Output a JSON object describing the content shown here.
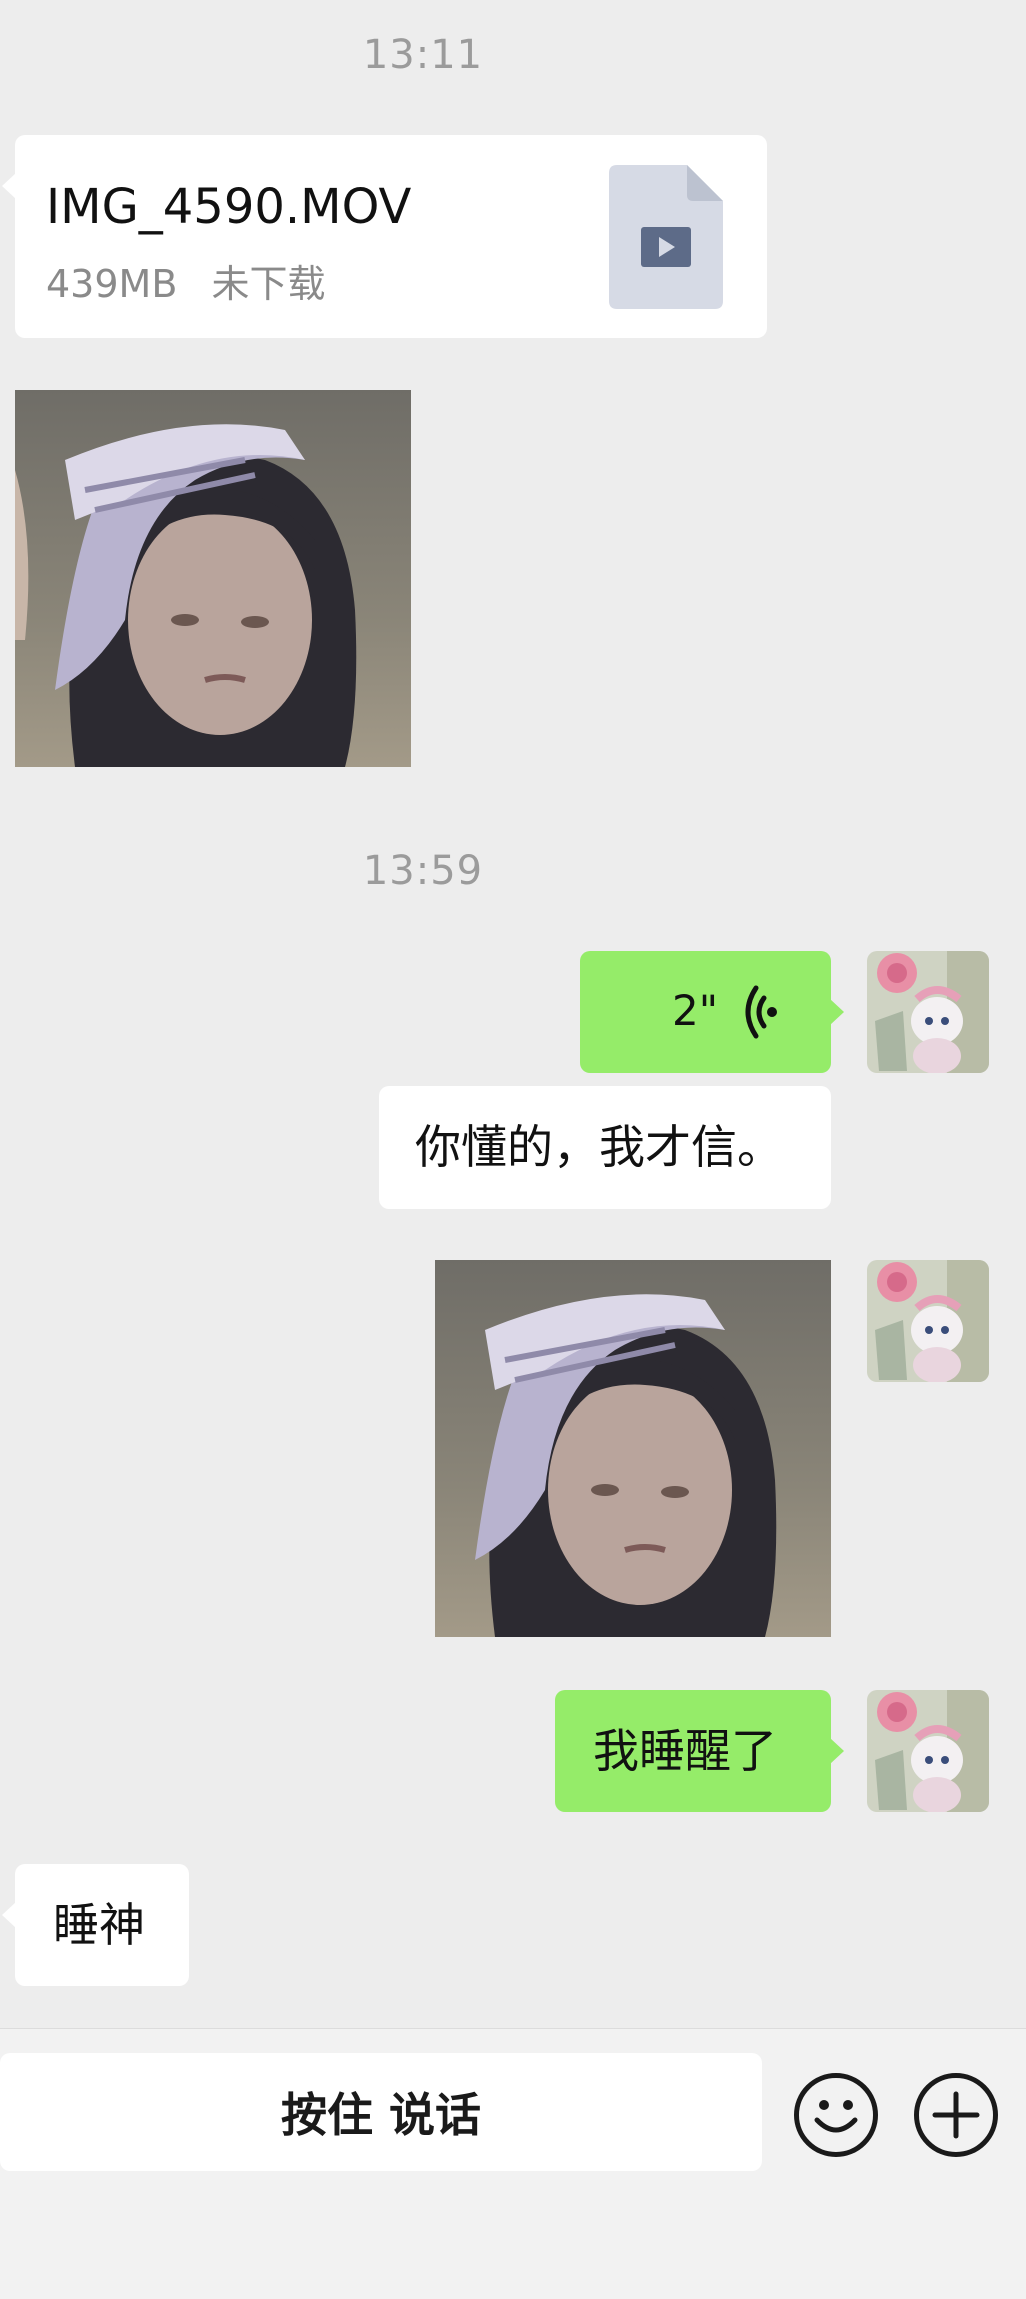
{
  "timestamps": [
    "13:11",
    "13:59"
  ],
  "file_message": {
    "filename": "IMG_4590.MOV",
    "size": "439MB",
    "status": "未下载",
    "icon": "video-file-icon"
  },
  "voice_message": {
    "duration": "2\"",
    "icon": "voice-wave-icon"
  },
  "messages": {
    "reply_quote": "你懂的，我才信。",
    "sent_text": "我睡醒了",
    "received_text": "睡神"
  },
  "input_bar": {
    "hold_to_talk": "按住 说话",
    "emoji_icon": "emoji-icon",
    "plus_icon": "plus-icon"
  },
  "colors": {
    "background": "#ededed",
    "sent_bubble": "#95ec69",
    "received_bubble": "#ffffff"
  }
}
